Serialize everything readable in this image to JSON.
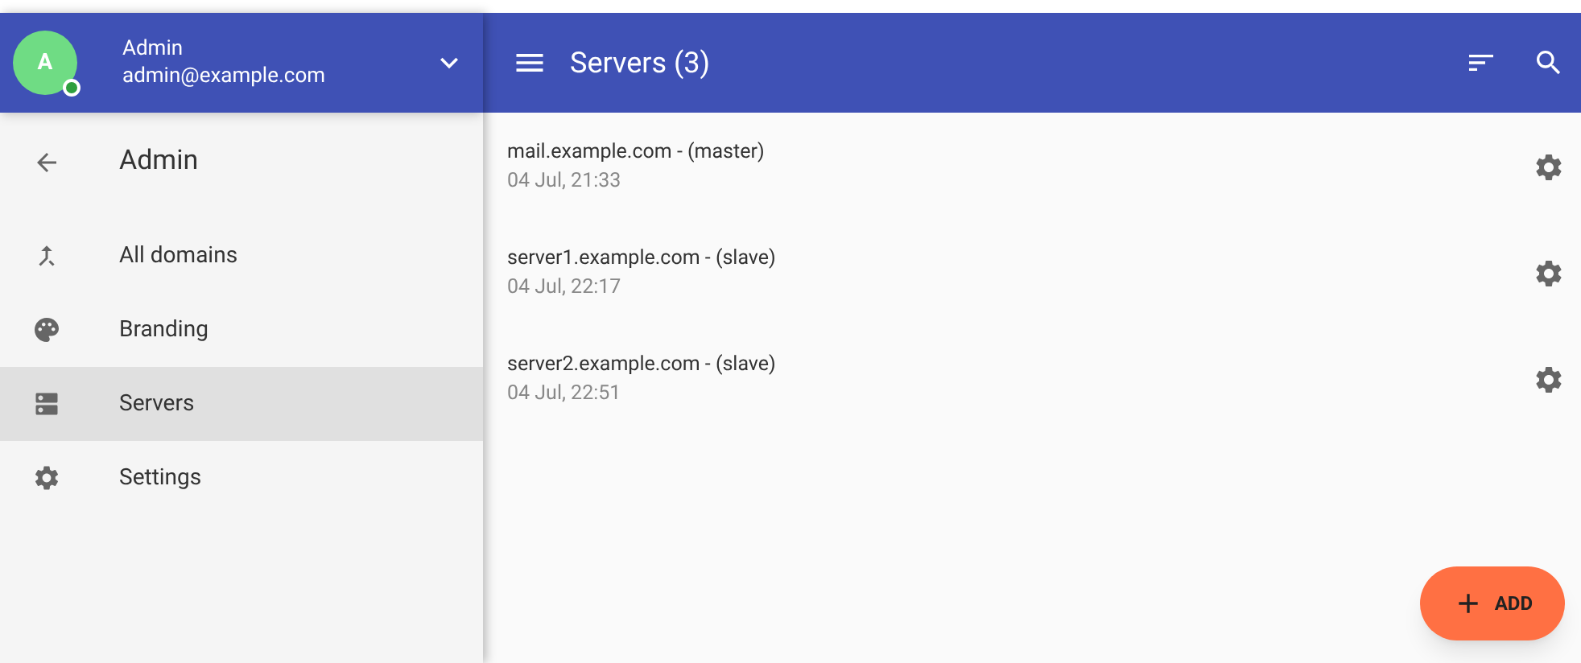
{
  "account": {
    "initial": "A",
    "name": "Admin",
    "email": "admin@example.com",
    "online": true
  },
  "sidebar": {
    "title": "Admin",
    "items": [
      {
        "label": "All domains",
        "kind": "domains",
        "selected": false
      },
      {
        "label": "Branding",
        "kind": "branding",
        "selected": false
      },
      {
        "label": "Servers",
        "kind": "servers",
        "selected": true
      },
      {
        "label": "Settings",
        "kind": "settings",
        "selected": false
      }
    ]
  },
  "toolbar": {
    "title": "Servers (3)"
  },
  "servers": [
    {
      "name": "mail.example.com - (master)",
      "time": "04 Jul, 21:33"
    },
    {
      "name": "server1.example.com - (slave)",
      "time": "04 Jul, 22:17"
    },
    {
      "name": "server2.example.com - (slave)",
      "time": "04 Jul, 22:51"
    }
  ],
  "add_button": {
    "label": "ADD"
  }
}
